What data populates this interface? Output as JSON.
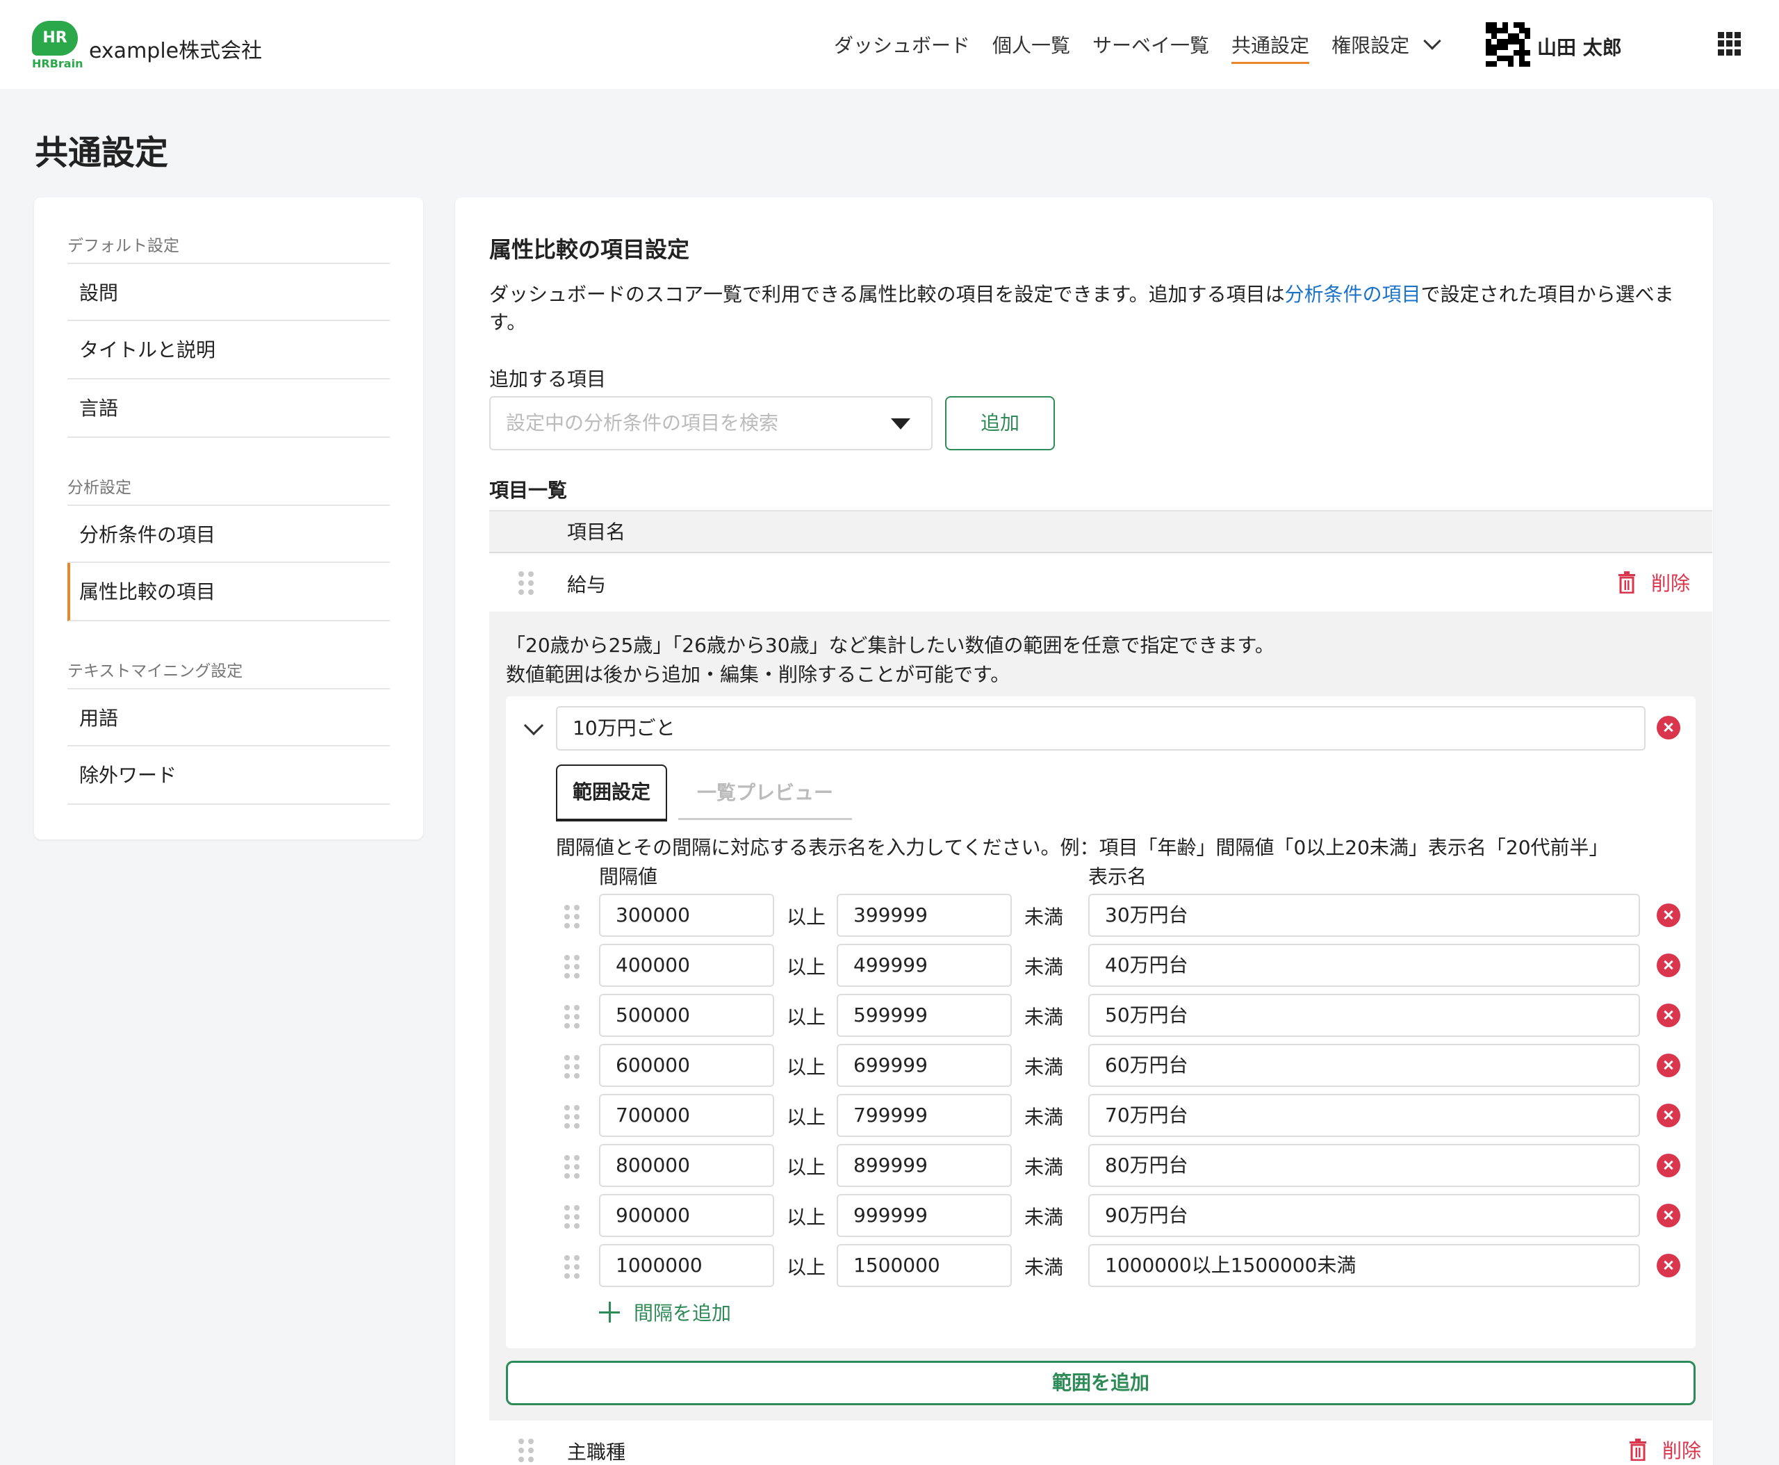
{
  "header": {
    "logo_text": "HR",
    "logo_sub": "HRBrain",
    "company": "example株式会社",
    "nav": [
      "ダッシュボード",
      "個人一覧",
      "サーベイ一覧",
      "共通設定",
      "権限設定"
    ],
    "username": "山田 太郎",
    "accent_color": "#e8862a"
  },
  "page": {
    "title": "共通設定"
  },
  "sidebar": {
    "groups": [
      {
        "label": "デフォルト設定",
        "items": [
          "設問",
          "タイトルと説明",
          "言語"
        ]
      },
      {
        "label": "分析設定",
        "items": [
          "分析条件の項目",
          "属性比較の項目"
        ]
      },
      {
        "label": "テキストマイニング設定",
        "items": [
          "用語",
          "除外ワード"
        ]
      }
    ],
    "active_item": "属性比較の項目"
  },
  "main": {
    "section_title": "属性比較の項目設定",
    "desc_before": "ダッシュボードのスコア一覧で利用できる属性比較の項目を設定できます。追加する項目は",
    "desc_link": "分析条件の項目",
    "desc_after": "で設定された項目から選べます。",
    "add_label": "追加する項目",
    "select_placeholder": "設定中の分析条件の項目を検索",
    "add_button": "追加",
    "list_label": "項目一覧",
    "column_header": "項目名",
    "delete_label": "削除",
    "items": [
      "給与",
      "主職種"
    ],
    "expand": {
      "hint_line1": "「20歳から25歳」「26歳から30歳」など集計したい数値の範囲を任意で指定できます。",
      "hint_line2": "数値範囲は後から追加・編集・削除することが可能です。",
      "range_name": "10万円ごと",
      "tabs": [
        "範囲設定",
        "一覧プレビュー"
      ],
      "interval_hint": "間隔値とその間隔に対応する表示名を入力してください。例：項目「年齢」間隔値「0以上20未満」表示名「20代前半」",
      "col_interval": "間隔値",
      "col_display": "表示名",
      "unit_from": "以上",
      "unit_to": "未満",
      "intervals": [
        {
          "from": "300000",
          "to": "399999",
          "name": "30万円台"
        },
        {
          "from": "400000",
          "to": "499999",
          "name": "40万円台"
        },
        {
          "from": "500000",
          "to": "599999",
          "name": "50万円台"
        },
        {
          "from": "600000",
          "to": "699999",
          "name": "60万円台"
        },
        {
          "from": "700000",
          "to": "799999",
          "name": "70万円台"
        },
        {
          "from": "800000",
          "to": "899999",
          "name": "80万円台"
        },
        {
          "from": "900000",
          "to": "999999",
          "name": "90万円台"
        },
        {
          "from": "1000000",
          "to": "1500000",
          "name": "1000000以上1500000未満"
        }
      ],
      "add_interval": "間隔を追加",
      "add_range": "範囲を追加"
    }
  }
}
